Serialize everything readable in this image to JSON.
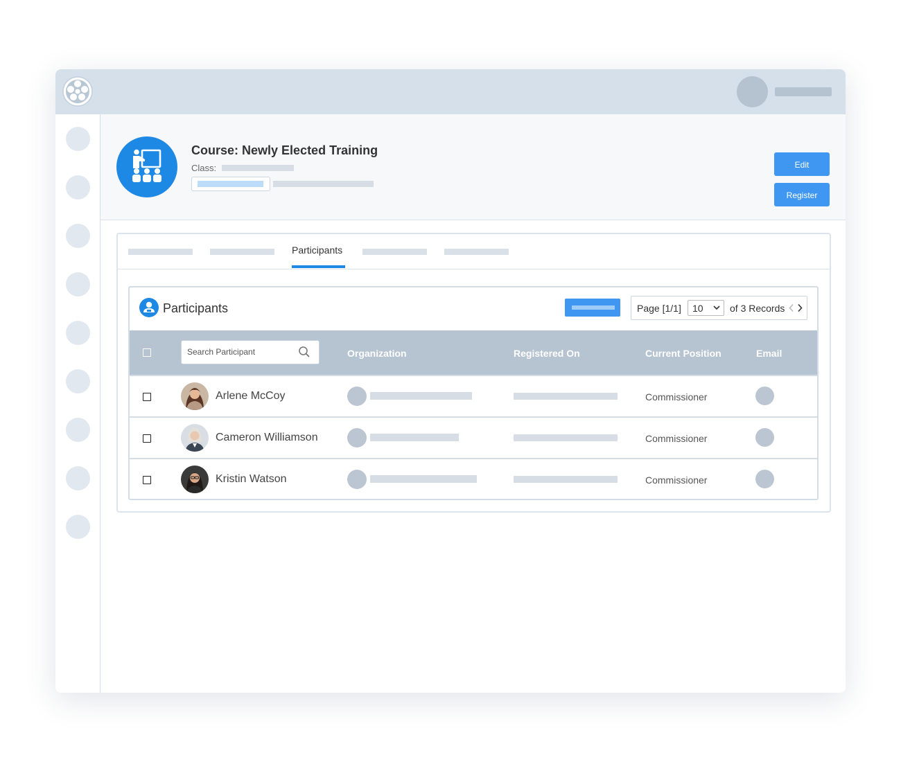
{
  "course": {
    "title": "Course: Newly Elected Training",
    "class_label": "Class:",
    "icon": "classroom-teacher-icon"
  },
  "actions": {
    "edit_label": "Edit",
    "register_label": "Register"
  },
  "tabs": {
    "active_label": "Participants"
  },
  "participants": {
    "title": "Participants",
    "icon": "participant-user-icon",
    "search_placeholder": "Search Participant",
    "pager": {
      "page": "Page [1/1]",
      "page_size": "10",
      "records": "of 3 Records"
    },
    "columns": {
      "organization": "Organization",
      "registered_on": "Registered On",
      "current_position": "Current Position",
      "email": "Email"
    },
    "rows": [
      {
        "name": "Arlene McCoy",
        "position": "Commissioner"
      },
      {
        "name": "Cameron Williamson",
        "position": "Commissioner"
      },
      {
        "name": "Kristin Watson",
        "position": "Commissioner"
      }
    ]
  },
  "colors": {
    "accent": "#1e88e5",
    "button": "#3f97f2",
    "topbar": "#d5e0ea",
    "table_header": "#b6c3d1"
  }
}
